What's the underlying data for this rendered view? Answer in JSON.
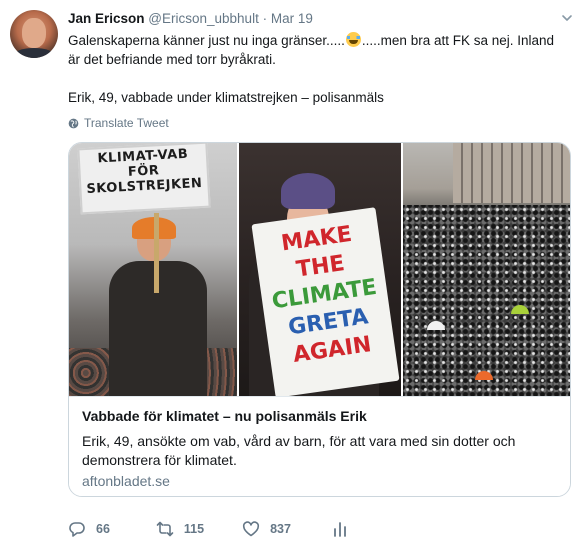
{
  "author": {
    "name": "Jan Ericson",
    "handle": "@Ericson_ubbhult",
    "separator": "·",
    "date": "Mar 19"
  },
  "tweet": {
    "line1_a": "Galenskaperna känner just nu inga gränser.....",
    "line1_emoji": "face-with-tears-of-joy",
    "line1_b": ".....men bra att FK sa nej. Inland",
    "line2": "är det befriande med torr byråkrati.",
    "line4": "Erik, 49, vabbade under klimatstrejken  – polisanmäls"
  },
  "translate_label": "Translate Tweet",
  "card": {
    "sign1": [
      "KLIMAT-VAB",
      "FÖR",
      "SKOLSTREJKEN"
    ],
    "sign2": [
      "MAKE",
      "THE",
      "CLIMATE",
      "GRETA",
      "AGAIN"
    ],
    "title": "Vabbade för klimatet – nu polisanmäls Erik",
    "description": "Erik, 49, ansökte om vab, vård av barn, för att vara med sin dotter och demonstrera för klimatet.",
    "domain": "aftonbladet.se"
  },
  "actions": {
    "replies": "66",
    "retweets": "115",
    "likes": "837"
  },
  "colors": {
    "text": "#14171a",
    "secondary": "#657786",
    "border": "#ccd6dd"
  }
}
